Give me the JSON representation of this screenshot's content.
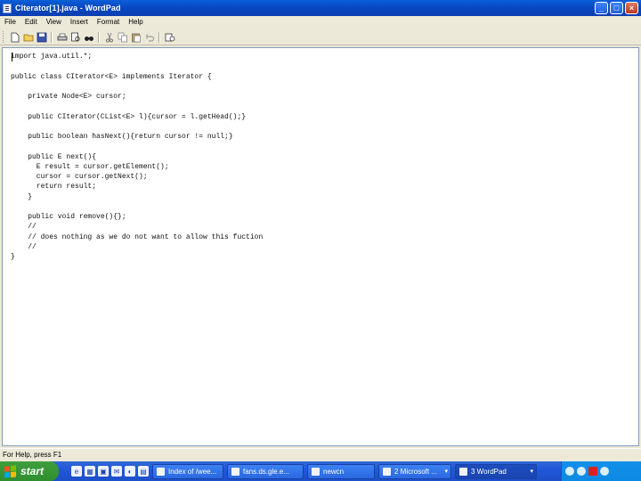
{
  "window": {
    "title": "CIterator[1].java - WordPad",
    "controls": [
      "_",
      "□",
      "×"
    ]
  },
  "menu": [
    "File",
    "Edit",
    "View",
    "Insert",
    "Format",
    "Help"
  ],
  "toolbar": [
    {
      "name": "new-icon",
      "glyph": "new"
    },
    {
      "name": "open-icon",
      "glyph": "open"
    },
    {
      "name": "save-icon",
      "glyph": "save"
    },
    {
      "name": "print-icon",
      "glyph": "print"
    },
    {
      "name": "print-preview-icon",
      "glyph": "preview"
    },
    {
      "name": "find-icon",
      "glyph": "find"
    },
    {
      "name": "cut-icon",
      "glyph": "cut"
    },
    {
      "name": "copy-icon",
      "glyph": "copy"
    },
    {
      "name": "paste-icon",
      "glyph": "paste"
    },
    {
      "name": "undo-icon",
      "glyph": "undo"
    },
    {
      "name": "date-time-icon",
      "glyph": "date"
    }
  ],
  "document": {
    "lines": [
      "import java.util.*;",
      "",
      "public class CIterator<E> implements Iterator {",
      "",
      "    private Node<E> cursor;",
      "",
      "    public CIterator(CList<E> l){cursor = l.getHead();}",
      "",
      "    public boolean hasNext(){return cursor != null;}",
      "",
      "    public E next(){",
      "      E result = cursor.getElement();",
      "      cursor = cursor.getNext();",
      "      return result;",
      "    }",
      "",
      "    public void remove(){};",
      "    //",
      "    // does nothing as we do not want to allow this fuction",
      "    //",
      "}"
    ]
  },
  "status": {
    "text": "For Help, press F1"
  },
  "taskbar": {
    "start_label": "start",
    "quick_launch": [
      "e",
      "▦",
      "▣",
      "✉",
      "◐",
      "▤"
    ],
    "tasks": [
      {
        "label": "Index of /wee...",
        "active": false,
        "width": 80
      },
      {
        "label": "fans.ds.gle.e...",
        "active": false,
        "width": 86
      },
      {
        "label": "newcn",
        "active": false,
        "width": 76
      },
      {
        "label": "2 Microsoft ...",
        "active": false,
        "width": 82,
        "arrow": true
      },
      {
        "label": "3 WordPad",
        "active": true,
        "width": 92,
        "arrow": true
      }
    ]
  }
}
